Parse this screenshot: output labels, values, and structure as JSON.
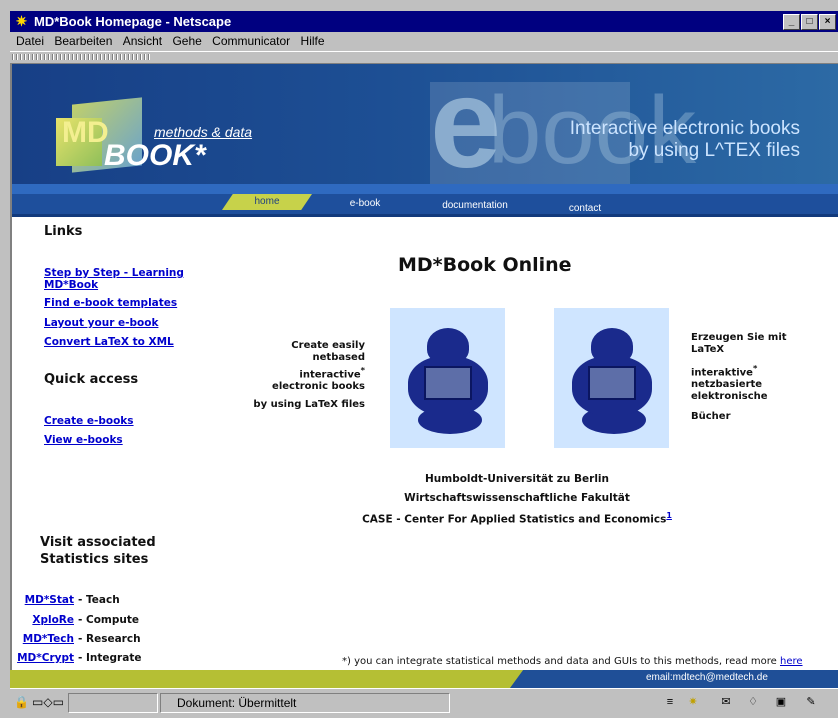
{
  "window": {
    "title": "MD*Book Homepage - Netscape",
    "menu": [
      "Datei",
      "Bearbeiten",
      "Ansicht",
      "Gehe",
      "Communicator",
      "Hilfe"
    ]
  },
  "header": {
    "logo_tag": "methods & data",
    "logo_md": "MD",
    "logo_book": "BOOK*",
    "big_e": "e",
    "big_book": "book",
    "title_line1": "Interactive electronic books",
    "title_line2": "by using L^TEX files"
  },
  "nav": [
    "home",
    "e-book",
    "documentation",
    "contact"
  ],
  "sidebar": {
    "links_heading": "Links",
    "links": [
      "Step by Step - Learning MD*Book",
      "Find e-book templates",
      "Layout your e-book",
      "Convert LaTeX to XML"
    ],
    "quick_heading": "Quick access",
    "quick": [
      "Create e-books",
      "View e-books"
    ],
    "visit_heading": "Visit associated Statistics sites",
    "assoc": [
      {
        "link": "MD*Stat",
        "desc": "- Teach"
      },
      {
        "link": "XploRe",
        "desc": "- Compute"
      },
      {
        "link": "MD*Tech",
        "desc": "- Research"
      },
      {
        "link": "MD*Crypt",
        "desc": "- Integrate"
      }
    ]
  },
  "main": {
    "title": "MD*Book Online",
    "left_blurb": [
      "Create easily",
      "netbased",
      "interactive",
      "electronic books",
      "by using LaTeX files"
    ],
    "right_blurb": [
      "Erzeugen Sie mit",
      "LaTeX",
      "interaktive",
      "netzbasierte",
      "elektronische",
      "Bücher"
    ],
    "star": "*",
    "institution": [
      "Humboldt-Universität zu Berlin",
      "Wirtschaftswissenschaftliche Fakultät",
      "CASE - Center For Applied Statistics and Economics"
    ],
    "footnote_number": "1",
    "note": "*) you can integrate statistical methods and data and GUIs to this methods, read more",
    "note_link": "here",
    "email": "email:mdtech@medtech.de"
  },
  "status": {
    "text": "Dokument: Übermittelt"
  }
}
